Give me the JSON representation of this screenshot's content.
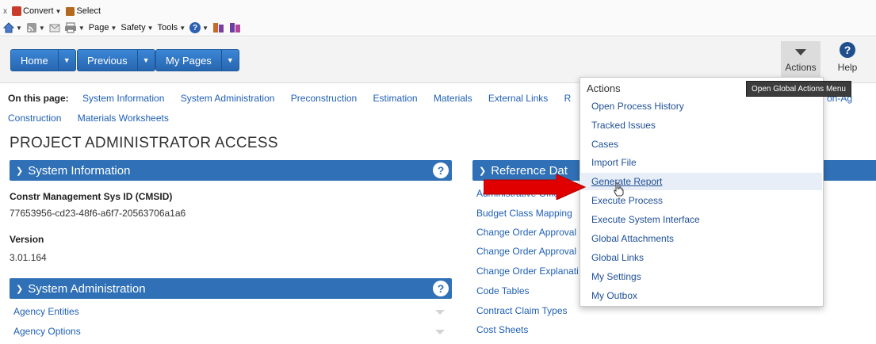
{
  "ie_toolbar": {
    "close_glyph": "x",
    "convert_label": "Convert",
    "select_label": "Select",
    "page_label": "Page",
    "safety_label": "Safety",
    "tools_label": "Tools"
  },
  "header": {
    "nav_buttons": [
      {
        "label": "Home"
      },
      {
        "label": "Previous"
      },
      {
        "label": "My Pages"
      }
    ],
    "actions_label": "Actions",
    "help_label": "Help",
    "help_glyph": "?"
  },
  "on_this_page": {
    "label": "On this page:",
    "links": [
      "System Information",
      "System Administration",
      "Preconstruction",
      "Estimation",
      "Materials",
      "External Links",
      "R"
    ],
    "links_row2": [
      "Construction",
      "Materials Worksheets"
    ],
    "tail_text": "on-Ag"
  },
  "page_title": "PROJECT ADMINISTRATOR ACCESS",
  "system_information": {
    "title": "System Information",
    "cmsid_label": "Constr Management Sys ID (CMSID)",
    "cmsid_value": "77653956-cd23-48f6-a6f7-20563706a1a6",
    "version_label": "Version",
    "version_value": "3.01.164"
  },
  "system_administration": {
    "title": "System Administration",
    "links": [
      "Agency Entities",
      "Agency Options"
    ]
  },
  "reference_data": {
    "title": "Reference Dat",
    "links": [
      "Administrative Office",
      "Budget Class Mapping",
      "Change Order Approval",
      "Change Order Approval",
      "Change Order Explanati",
      "Code Tables",
      "Contract Claim Types",
      "Cost Sheets"
    ]
  },
  "actions_menu": {
    "title": "Actions",
    "items": [
      "Open Process History",
      "Tracked Issues",
      "Cases",
      "Import File",
      "Generate Report",
      "Execute Process",
      "Execute System Interface",
      "Global Attachments",
      "Global Links",
      "My Settings",
      "My Outbox"
    ],
    "highlighted_index": 4
  },
  "tooltip": "Open Global Actions Menu",
  "colors": {
    "panel_blue": "#2f70b6",
    "link_blue": "#1f5fb5",
    "arrow_red": "#e00000"
  }
}
